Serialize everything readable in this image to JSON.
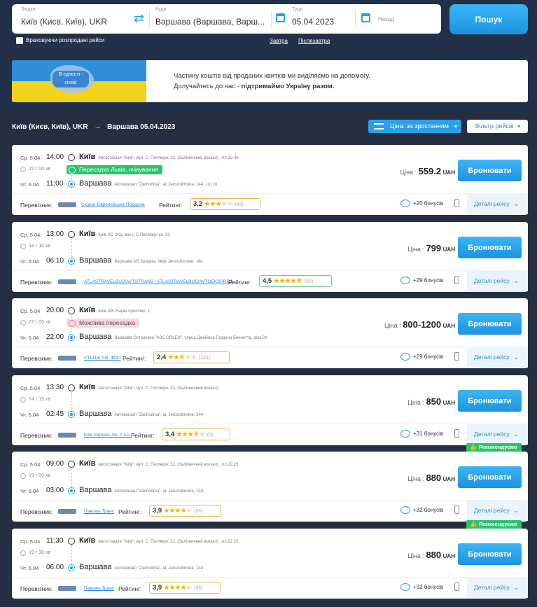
{
  "search": {
    "from_label": "Звідки",
    "from_value": "Київ (Києв, Київ), UKR",
    "to_label": "Куди",
    "to_value": "Варшава (Варшава, Варш...",
    "date_label": "Туди",
    "date_value": "05.04.2023",
    "return_label": "Назад",
    "button": "Пошук",
    "sold_out_label": "Враховуючи розпродані рейси",
    "tomorrow": "Завтра",
    "day_after": "Післязавтра"
  },
  "banner": {
    "badge": "В єдності - сила!",
    "line1": "Частину коштів від проданих квитків ми виділяємо на допомогу.",
    "line2_prefix": "Долучайтесь до нас - ",
    "line2_bold": "підтримаймо Україну разом."
  },
  "route_header": {
    "from": "Київ (Києв, Київ), UKR",
    "arrow": "→",
    "to_date": "Варшава 05.04.2023"
  },
  "sort_label": "Ціна: за зростанням",
  "filter_label": "Фільтр рейсів",
  "labels": {
    "carrier": "Перевізник:",
    "rating": "Рейтинг:",
    "price": "Ціна :",
    "book": "Бронювати",
    "details": "Деталі рейсу",
    "recommended": "Рекомендуємо"
  },
  "trips": [
    {
      "dep_date": "Ср. 5.04",
      "dep_time": "14:00",
      "dep_city": "Київ",
      "dep_addr": "Автостанція \"Київ\", вул. С. Петлюри, 32, (Залізничний вокзал) , пл.32-36",
      "duration": "22 г 00 хв",
      "tag": "Пересадка Львів, очікування",
      "tag_type": "green",
      "arr_date": "Чт. 6.04",
      "arr_time": "11:00",
      "arr_city": "Варшава",
      "arr_addr": "Автовокзал \"Zachodnia\", al. Jerozolimskie, 144 , пл.10",
      "carrier": "Східно-Європейська Подорож",
      "rating": "3,2",
      "stars": 3,
      "reviews": "(43)",
      "price": "559.2",
      "currency": "UAH",
      "bonus": "+20 бонусів",
      "recommended": false
    },
    {
      "dep_date": "Ср. 5.04",
      "dep_time": "13:00",
      "dep_city": "Київ",
      "dep_addr": "Київ АС (Жд. вок.), С.Петлюри ул. 32",
      "duration": "18 г 10 хв",
      "tag": "",
      "tag_type": "",
      "arr_date": "Чт. 6.04",
      "arr_time": "06:10",
      "arr_city": "Варшава",
      "arr_addr": "Варшава АВ Західна, Aleje Jerozolimskie, 144",
      "carrier": "ATLASTRAVELBUS/AVTOTRANS / ATLASTRAVELBUS/AVTOEKSPRES",
      "rating": "4,5",
      "stars": 4.5,
      "reviews": "(55)",
      "price": "799",
      "currency": "UAH",
      "bonus": "+29 бонусів",
      "recommended": false
    },
    {
      "dep_date": "Ср. 5.04",
      "dep_time": "20:00",
      "dep_city": "Київ",
      "dep_addr": "Київ АВ, Науки проспект, 1",
      "duration": "27 г 00 хв",
      "tag": "Можлива пересадка",
      "tag_type": "pink",
      "arr_date": "Чт. 6.04",
      "arr_time": "22:00",
      "arr_city": "Варшава",
      "arr_addr": "Варшава Остановка \"АЗС ORLEN\", улица Джеймса Гордона Беннетта, дом 2А",
      "carrier": "СТЕЦІК Т.В. ФОП",
      "rating": "2,4",
      "stars": 2.5,
      "reviews": "(144)",
      "price": "800-1200",
      "currency": "UAH",
      "bonus": "+29 бонусів",
      "recommended": false
    },
    {
      "dep_date": "Ср. 5.04",
      "dep_time": "13:30",
      "dep_city": "Київ",
      "dep_addr": "Автостанція \"Київ\", вул. С. Петлюри, 32, (Залізничний вокзал)",
      "duration": "14 г 15 хв",
      "tag": "",
      "tag_type": "",
      "arr_date": "Чт. 6.04",
      "arr_time": "02:45",
      "arr_city": "Варшава",
      "arr_addr": "Автовокзал \"Zachodnia\", al. Jerozolimskie, 144",
      "carrier": "Elite Express Sp. z o.o.",
      "rating": "3,4",
      "stars": 3.5,
      "reviews": "(8)",
      "price": "850",
      "currency": "UAH",
      "bonus": "+31 бонусів",
      "recommended": false
    },
    {
      "dep_date": "Ср. 5.04",
      "dep_time": "09:00",
      "dep_city": "Київ",
      "dep_addr": "Автостанція \"Київ\", вул. С. Петлюри, 32, (Залізничний вокзал) , пл.22,23",
      "duration": "19 г 00 хв",
      "tag": "",
      "tag_type": "",
      "arr_date": "Чт. 6.04",
      "arr_time": "03:00",
      "arr_city": "Варшава",
      "arr_addr": "Автовокзал \"Zachodnia\", al. Jerozolimskie, 144",
      "carrier": "Павлюк-Транс",
      "rating": "3,9",
      "stars": 4,
      "reviews": "(56)",
      "price": "880",
      "currency": "UAH",
      "bonus": "+32 бонусів",
      "recommended": true
    },
    {
      "dep_date": "Ср. 5.04",
      "dep_time": "11:30",
      "dep_city": "Київ",
      "dep_addr": "Автостанція \"Київ\", вул. С. Петлюри, 32, (Залізничний вокзал) , пл.22,23",
      "duration": "19 г 30 хв",
      "tag": "",
      "tag_type": "",
      "arr_date": "Чт. 6.04",
      "arr_time": "06:00",
      "arr_city": "Варшава",
      "arr_addr": "Автовокзал \"Zachodnia\", al. Jerozolimskie, 144",
      "carrier": "Павлюк-Транс",
      "rating": "3,9",
      "stars": 4,
      "reviews": "(56)",
      "price": "880",
      "currency": "UAH",
      "bonus": "+32 бонусів",
      "recommended": true
    }
  ]
}
